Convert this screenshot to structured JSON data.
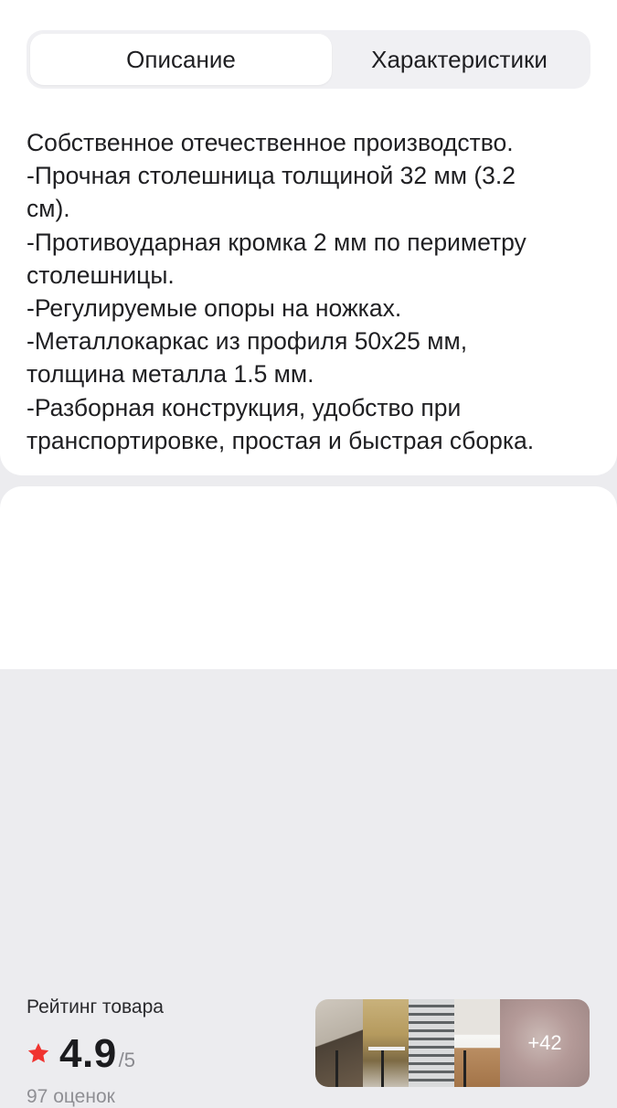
{
  "tabs": {
    "description": "Описание",
    "specifications": "Характеристики",
    "active": "description"
  },
  "description_lines": [
    "Собственное отечественное производство.",
    "-Прочная столешница толщиной 32 мм (3.2",
    "см).",
    "-Противоударная кромка 2 мм по периметру",
    "столешницы.",
    "-Регулируемые опоры на ножках.",
    "-Металлокаркас из профиля 50х25 мм,",
    "толщина металла 1.5 мм.",
    "-Разборная конструкция, удобство при",
    "транспортировке, простая и быстрая сборка."
  ],
  "rating": {
    "title": "Рейтинг товара",
    "score": "4.9",
    "out_of": "/5",
    "count": "97 оценок",
    "star_color": "#f0332f"
  },
  "gallery": {
    "more_label": "+42"
  }
}
